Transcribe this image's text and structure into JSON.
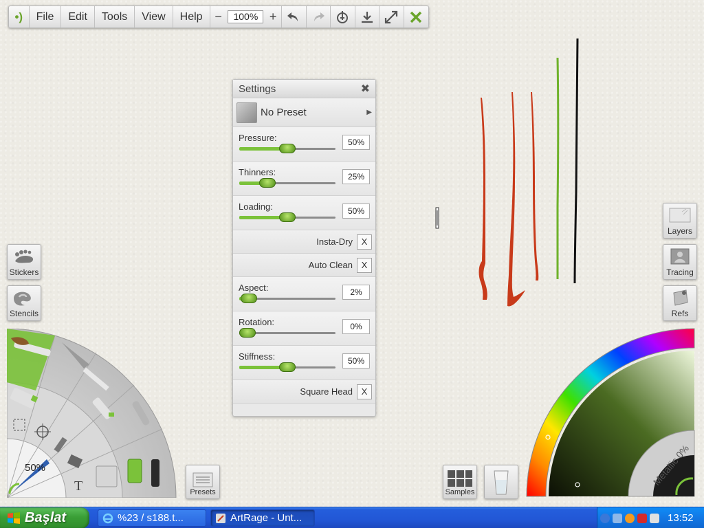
{
  "menubar": {
    "menus": [
      "File",
      "Edit",
      "Tools",
      "View",
      "Help"
    ],
    "zoom_minus": "−",
    "zoom_value": "100%",
    "zoom_plus": "+",
    "icons": [
      "undo-icon",
      "redo-icon",
      "transform-icon",
      "save-icon",
      "fullscreen-icon",
      "close-icon"
    ]
  },
  "settings": {
    "title": "Settings",
    "close": "✖",
    "preset": "No Preset",
    "preset_arrow": "▶",
    "sliders": [
      {
        "label": "Pressure:",
        "value": "50%",
        "level": 0.5
      },
      {
        "label": "Thinners:",
        "value": "25%",
        "level": 0.25
      },
      {
        "label": "Loading:",
        "value": "50%",
        "level": 0.5
      },
      {
        "label": "Aspect:",
        "value": "2%",
        "level": 0.02
      },
      {
        "label": "Rotation:",
        "value": "0%",
        "level": 0.0
      },
      {
        "label": "Stiffness:",
        "value": "50%",
        "level": 0.5
      }
    ],
    "toggles": [
      {
        "label": "Insta-Dry",
        "mark": "X"
      },
      {
        "label": "Auto Clean",
        "mark": "X"
      },
      {
        "label": "Square Head",
        "mark": "X"
      }
    ]
  },
  "left_buttons": {
    "stickers": "Stickers",
    "stencils": "Stencils"
  },
  "right_buttons": {
    "layers": "Layers",
    "tracing": "Tracing",
    "refs": "Refs"
  },
  "toolwheel": {
    "size_percent": "50%",
    "text_tool": "T"
  },
  "presets_button": "Presets",
  "samples_button": "Samples",
  "colorwheel": {
    "metallic_label": "Metallic 0%"
  },
  "colors": {
    "accent_green": "#7bc23a",
    "stroke_red": "#c83a1a",
    "stroke_green": "#6fb22a",
    "stroke_black": "#111111"
  },
  "taskbar": {
    "start_label": "Başlat",
    "tasks": [
      "%23 / s188.t...",
      "ArtRage - Unt..."
    ],
    "clock": "13:52"
  }
}
